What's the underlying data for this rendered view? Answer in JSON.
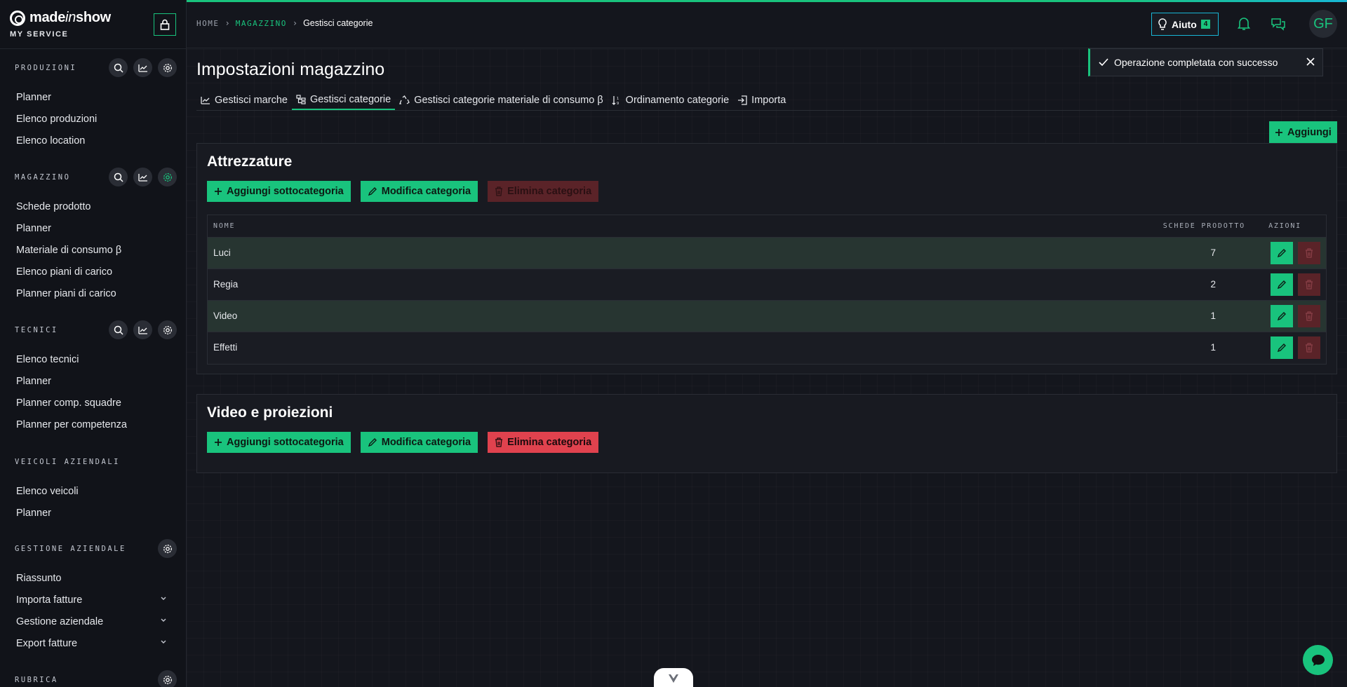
{
  "brand": {
    "name_part1": "made",
    "name_part2": "in",
    "name_part3": "show",
    "subtitle": "MY SERVICE"
  },
  "sidebar": {
    "sections": [
      {
        "title": "PRODUZIONI",
        "items": [
          "Planner",
          "Elenco produzioni",
          "Elenco location"
        ]
      },
      {
        "title": "MAGAZZINO",
        "items": [
          "Schede prodotto",
          "Planner",
          "Materiale di consumo β",
          "Elenco piani di carico",
          "Planner piani di carico"
        ]
      },
      {
        "title": "TECNICI",
        "items": [
          "Elenco tecnici",
          "Planner",
          "Planner comp. squadre",
          "Planner per competenza"
        ]
      },
      {
        "title": "VEICOLI AZIENDALI",
        "items": [
          "Elenco veicoli",
          "Planner"
        ]
      },
      {
        "title": "GESTIONE AZIENDALE",
        "items": [
          "Riassunto",
          "Importa fatture",
          "Gestione aziendale",
          "Export fatture"
        ]
      },
      {
        "title": "RUBRICA"
      }
    ]
  },
  "topbar": {
    "breadcrumb": {
      "home": "HOME",
      "section": "MAGAZZINO",
      "current": "Gestisci categorie"
    },
    "help_label": "Aiuto",
    "help_count": "4",
    "avatar_initials": "GF"
  },
  "page": {
    "title": "Impostazioni magazzino",
    "tabs": [
      "Gestisci marche",
      "Gestisci categorie",
      "Gestisci categorie materiale di consumo β",
      "Ordinamento categorie",
      "Importa"
    ],
    "add_label": "Aggiungi"
  },
  "toast": {
    "message": "Operazione completata con successo"
  },
  "categories": [
    {
      "title": "Attrezzature",
      "add_sub_label": "Aggiungi sottocategoria",
      "edit_label": "Modifica categoria",
      "delete_label": "Elimina categoria",
      "table": {
        "col_name": "NOME",
        "col_count": "SCHEDE PRODOTTO",
        "col_actions": "AZIONI",
        "rows": [
          {
            "name": "Luci",
            "count": "7"
          },
          {
            "name": "Regia",
            "count": "2"
          },
          {
            "name": "Video",
            "count": "1"
          },
          {
            "name": "Effetti",
            "count": "1"
          }
        ]
      }
    },
    {
      "title": "Video e proiezioni",
      "add_sub_label": "Aggiungi sottocategoria",
      "edit_label": "Modifica categoria",
      "delete_label": "Elimina categoria"
    }
  ],
  "colors": {
    "accent": "#19c37d",
    "danger": "#e0424e",
    "background": "#14161d",
    "sidebar": "#111319",
    "help_border": "#18b7d6"
  }
}
